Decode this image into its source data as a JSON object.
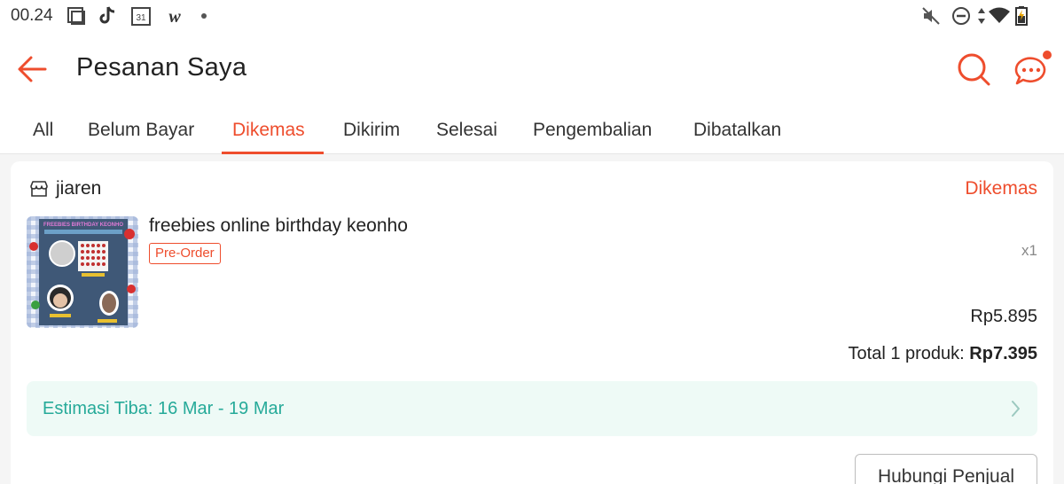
{
  "status_bar": {
    "time": "00.24",
    "calendar_day": "31",
    "w_app": "w"
  },
  "header": {
    "title": "Pesanan Saya"
  },
  "tabs": [
    {
      "label": "All"
    },
    {
      "label": "Belum Bayar"
    },
    {
      "label": "Dikemas",
      "active": true
    },
    {
      "label": "Dikirim"
    },
    {
      "label": "Selesai"
    },
    {
      "label": "Pengembalian"
    },
    {
      "label": "Dibatalkan"
    }
  ],
  "order": {
    "shop_name": "jiaren",
    "status": "Dikemas",
    "product": {
      "name": "freebies online birthday keonho",
      "badge": "Pre-Order",
      "qty": "x1",
      "price": "Rp5.895",
      "thumbnail_title": "FREEBIES BIRTHDAY KEONHO"
    },
    "total_label": "Total 1 produk:",
    "total_value": "Rp7.395",
    "estimate": "Estimasi Tiba: 16 Mar - 19 Mar",
    "contact_button": "Hubungi Penjual"
  },
  "colors": {
    "accent": "#ee4d2d",
    "teal": "#26aa99",
    "teal_bg": "#eefaf6"
  }
}
